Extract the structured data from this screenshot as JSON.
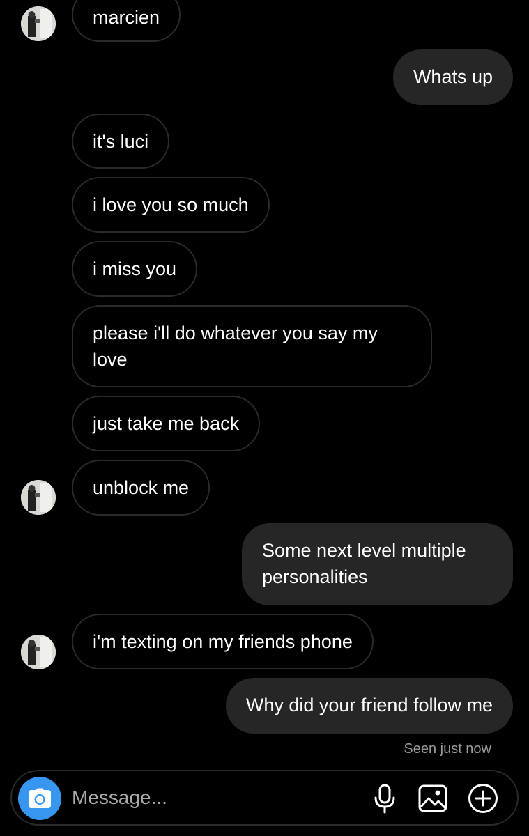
{
  "thread": {
    "messages": [
      {
        "side": "in",
        "text": "marcien"
      },
      {
        "side": "out",
        "text": "Whats up"
      },
      {
        "side": "in",
        "text": "it's luci"
      },
      {
        "side": "in",
        "text": "i love you so much"
      },
      {
        "side": "in",
        "text": "i miss you"
      },
      {
        "side": "in",
        "text": "please i'll do whatever you say my love"
      },
      {
        "side": "in",
        "text": "just take me back"
      },
      {
        "side": "in",
        "text": "unblock me"
      },
      {
        "side": "out",
        "text": "Some next level multiple personalities"
      },
      {
        "side": "in",
        "text": "i'm texting on my friends phone"
      },
      {
        "side": "out",
        "text": "Why did your friend follow me"
      }
    ],
    "seen_status": "Seen just now"
  },
  "composer": {
    "placeholder": "Message...",
    "icons": [
      "camera-icon",
      "microphone-icon",
      "gallery-icon",
      "add-icon"
    ],
    "accent_color": "#3797f0"
  },
  "colors": {
    "background": "#000000",
    "outgoing_bubble": "#262626",
    "incoming_border": "#2a2a2a"
  }
}
